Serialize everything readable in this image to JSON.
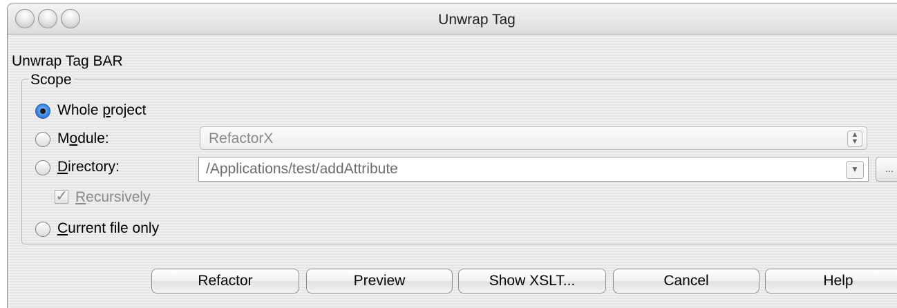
{
  "window": {
    "title": "Unwrap Tag"
  },
  "dialog": {
    "label": "Unwrap Tag BAR"
  },
  "scope": {
    "legend": "Scope",
    "options": {
      "whole_project": {
        "pre": "Whole ",
        "mnemonic": "p",
        "post": "roject",
        "selected": true
      },
      "module": {
        "pre": "M",
        "mnemonic": "o",
        "post": "dule:",
        "value": "RefactorX"
      },
      "directory": {
        "pre": "",
        "mnemonic": "D",
        "post": "irectory:",
        "value": "/Applications/test/addAttribute",
        "browse_label": "..."
      },
      "recursively": {
        "mnemonic": "R",
        "post": "ecursively",
        "checked": true
      },
      "current_file": {
        "mnemonic": "C",
        "post": "urrent file only"
      }
    }
  },
  "buttons": {
    "refactor": "Refactor",
    "preview": "Preview",
    "show_xslt": "Show XSLT...",
    "cancel": "Cancel",
    "help": "Help"
  }
}
